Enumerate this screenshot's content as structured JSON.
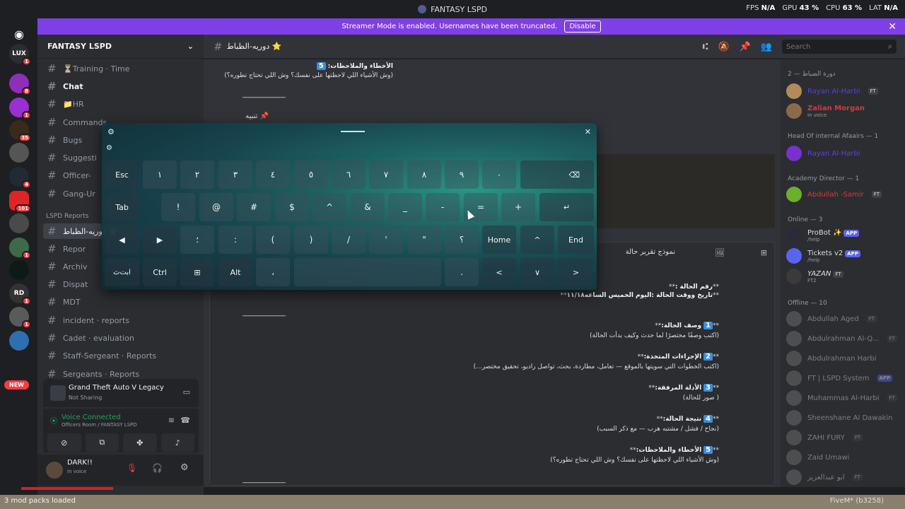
{
  "window": {
    "title": "FANTASY LSPD",
    "stats": {
      "fps_label": "FPS",
      "fps": "N/A",
      "gpu_label": "GPU",
      "gpu": "43 %",
      "cpu_label": "CPU",
      "cpu": "63 %",
      "lat_label": "LAT",
      "lat": "N/A"
    }
  },
  "banner": {
    "text": "Streamer Mode is enabled. Usernames have been truncated.",
    "button": "Disable",
    "close": "✕"
  },
  "rail": {
    "home_icon": "discord-icon",
    "servers": [
      {
        "label": "LUX",
        "badge": "1"
      },
      {
        "label": "",
        "badge": "8"
      },
      {
        "label": "",
        "badge": "1"
      },
      {
        "label": "",
        "badge": "35"
      },
      {
        "label": "",
        "badge": ""
      },
      {
        "label": "",
        "badge": "4"
      },
      {
        "label": "",
        "badge": "101"
      },
      {
        "label": "",
        "badge": ""
      },
      {
        "label": "",
        "badge": "1"
      },
      {
        "label": "",
        "badge": ""
      },
      {
        "label": "RD",
        "badge": "1"
      },
      {
        "label": "",
        "badge": "1"
      },
      {
        "label": "",
        "badge": ""
      }
    ],
    "new_badge": "NEW"
  },
  "sidebar": {
    "server_name": "FANTASY LSPD",
    "channels": [
      {
        "label": "⏳Training · Time"
      },
      {
        "label": "Chat"
      },
      {
        "label": "📁HR"
      },
      {
        "label": "Commands"
      },
      {
        "label": "Bugs"
      },
      {
        "label": "Suggesti"
      },
      {
        "label": "Officer-"
      },
      {
        "label": "Gang-Ur"
      }
    ],
    "category": "LSPD Reports",
    "reports": [
      {
        "label": "دوريه-الظباط ⭐"
      },
      {
        "label": "Repor"
      },
      {
        "label": "Archiv"
      },
      {
        "label": "Dispat"
      },
      {
        "label": "MDT"
      },
      {
        "label": "incident · reports"
      },
      {
        "label": "Cadet · evaluation"
      },
      {
        "label": "Staff-Sergeant · Reports"
      },
      {
        "label": "Sergeants · Reports"
      }
    ],
    "activity": {
      "game": "Grand Theft Auto V Legacy",
      "status": "Not Sharing"
    },
    "voice": {
      "status": "Voice Connected",
      "location": "Officers Room / FANTASY LSPD"
    },
    "user": {
      "name": "DARK!!",
      "status": "In voice"
    }
  },
  "header": {
    "channel": "دوريه-الظباط ⭐",
    "search_placeholder": "Search"
  },
  "messages": {
    "top_title": "الأخطاء والملاحظات:",
    "top_line": "(وش الأشياء اللي لاحظتها على نفسك؟ وش اللي تحتاج تطوره؟)",
    "separator": "_______________",
    "notice": "📌 تنبيه",
    "embed_title": "نموذج تقرير حالة",
    "case_number": "رقم الحالة :",
    "case_time": "تاريخ ووقت الحالة :اليوم الخميس الساعه١١/١٨",
    "sections": [
      {
        "n": "1",
        "title": "وصف الحالة:",
        "body": "(اكتب وصفًا مختصرًا لما حدث وكيف بدأت الحالة)"
      },
      {
        "n": "2",
        "title": "الإجراءات المتخذة:",
        "body": "(اكتب الخطوات التي سويتها بالموقع — تعامل، مطاردة، بحث، تواصل راديو، تحقيق مختصر...)"
      },
      {
        "n": "3",
        "title": "الأدلة المرفقة:",
        "body": "( صور للحالة)"
      },
      {
        "n": "4",
        "title": "نتيجة الحالة:",
        "body": "(نجاح / فشل / مشتبه هرب — مع ذكر السبب)"
      },
      {
        "n": "5",
        "title": "الأخطاء والملاحظات:",
        "body": "(وش الأشياء اللي لاحظتها على نفسك؟ وش اللي تحتاج تطوره؟)"
      }
    ]
  },
  "members": {
    "groups": [
      {
        "label": "دورة الضباط — 2"
      },
      {
        "label": "Head Of internal Afaairs — 1"
      },
      {
        "label": "Academy Director — 1"
      },
      {
        "label": "Online — 3"
      },
      {
        "label": "Offline — 10"
      }
    ],
    "online": [
      {
        "name": "Rayan Al-Harbi",
        "sub": "",
        "tag": "FT"
      },
      {
        "name": "Zalian Morgan",
        "sub": "In voice",
        "tag": ""
      },
      {
        "name": "Rayan Al-Harbi",
        "sub": "",
        "tag": ""
      },
      {
        "name": "Abdullah -Samir",
        "sub": "",
        "tag": "FT"
      },
      {
        "name": "ProBot ✨",
        "sub": "/help",
        "tag": "APP"
      },
      {
        "name": "Tickets v2",
        "sub": "/help",
        "tag": "APP"
      },
      {
        "name": "YAZAN",
        "sub": "FT2",
        "tag": "FT"
      }
    ],
    "offline": [
      {
        "name": "Abdullah Aged",
        "tag": "FT"
      },
      {
        "name": "Abdulrahman Al-Q...",
        "tag": "FT"
      },
      {
        "name": "Abdulrahman Harbi",
        "tag": ""
      },
      {
        "name": "FT | LSPD System",
        "tag": "APP"
      },
      {
        "name": "Muhammas Al-Harbi",
        "tag": "FT"
      },
      {
        "name": "Sheenshane Al Dawakin",
        "tag": ""
      },
      {
        "name": "ZAHI FURY",
        "tag": "FT"
      },
      {
        "name": "Zaid Umawi",
        "tag": ""
      },
      {
        "name": "ابو عبدالعزيز",
        "tag": "FT"
      }
    ]
  },
  "keyboard": {
    "row1": [
      "Esc",
      "١",
      "٢",
      "٣",
      "٤",
      "٥",
      "٦",
      "٧",
      "٨",
      "٩",
      "٠",
      "⌫"
    ],
    "row2": [
      "Tab",
      "!",
      "@",
      "#",
      "$",
      "^",
      "&",
      "_",
      "-",
      "=",
      "+",
      "↵"
    ],
    "row3": [
      "◀",
      "▶",
      "؛",
      ":",
      "(",
      ")",
      "/",
      "'",
      "\"",
      "؟",
      "Home",
      "^",
      "End"
    ],
    "row4": [
      "ابت‌ث",
      "Ctrl",
      "⊞",
      "Alt",
      "،",
      "",
      ".",
      "<",
      "∨",
      ">"
    ],
    "close": "✕",
    "settings": "⚙"
  },
  "bottombar": {
    "left": "3 mod packs loaded",
    "right": "FiveM* (b3258)"
  }
}
